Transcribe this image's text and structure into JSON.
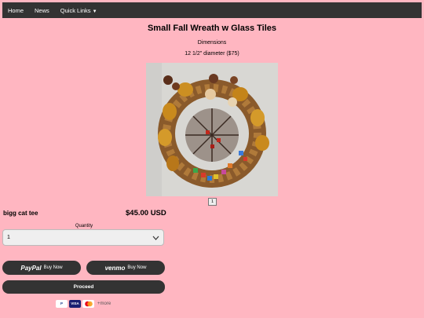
{
  "nav": {
    "home": "Home",
    "news": "News",
    "quick_links": "Quick Links"
  },
  "product": {
    "title": "Small Fall Wreath w Glass Tiles",
    "dimensions_label": "Dimensions",
    "dimensions_value": "12 1/2\" diameter ($75)",
    "image_page": "1",
    "name": "bigg cat tee",
    "price": "$45.00 USD"
  },
  "quantity": {
    "label": "Quantity",
    "value": "1"
  },
  "payment": {
    "paypal_logo": "PayPal",
    "paypal_label": "Buy Now",
    "venmo_logo": "venmo",
    "venmo_label": "Buy Now",
    "proceed_label": "Proceed",
    "card_paypal": "P",
    "card_visa": "VISA",
    "more_label": "+more"
  },
  "colors": {
    "page_bg": "#ffb6c1",
    "navbar_bg": "#333333",
    "button_bg": "#333333"
  }
}
